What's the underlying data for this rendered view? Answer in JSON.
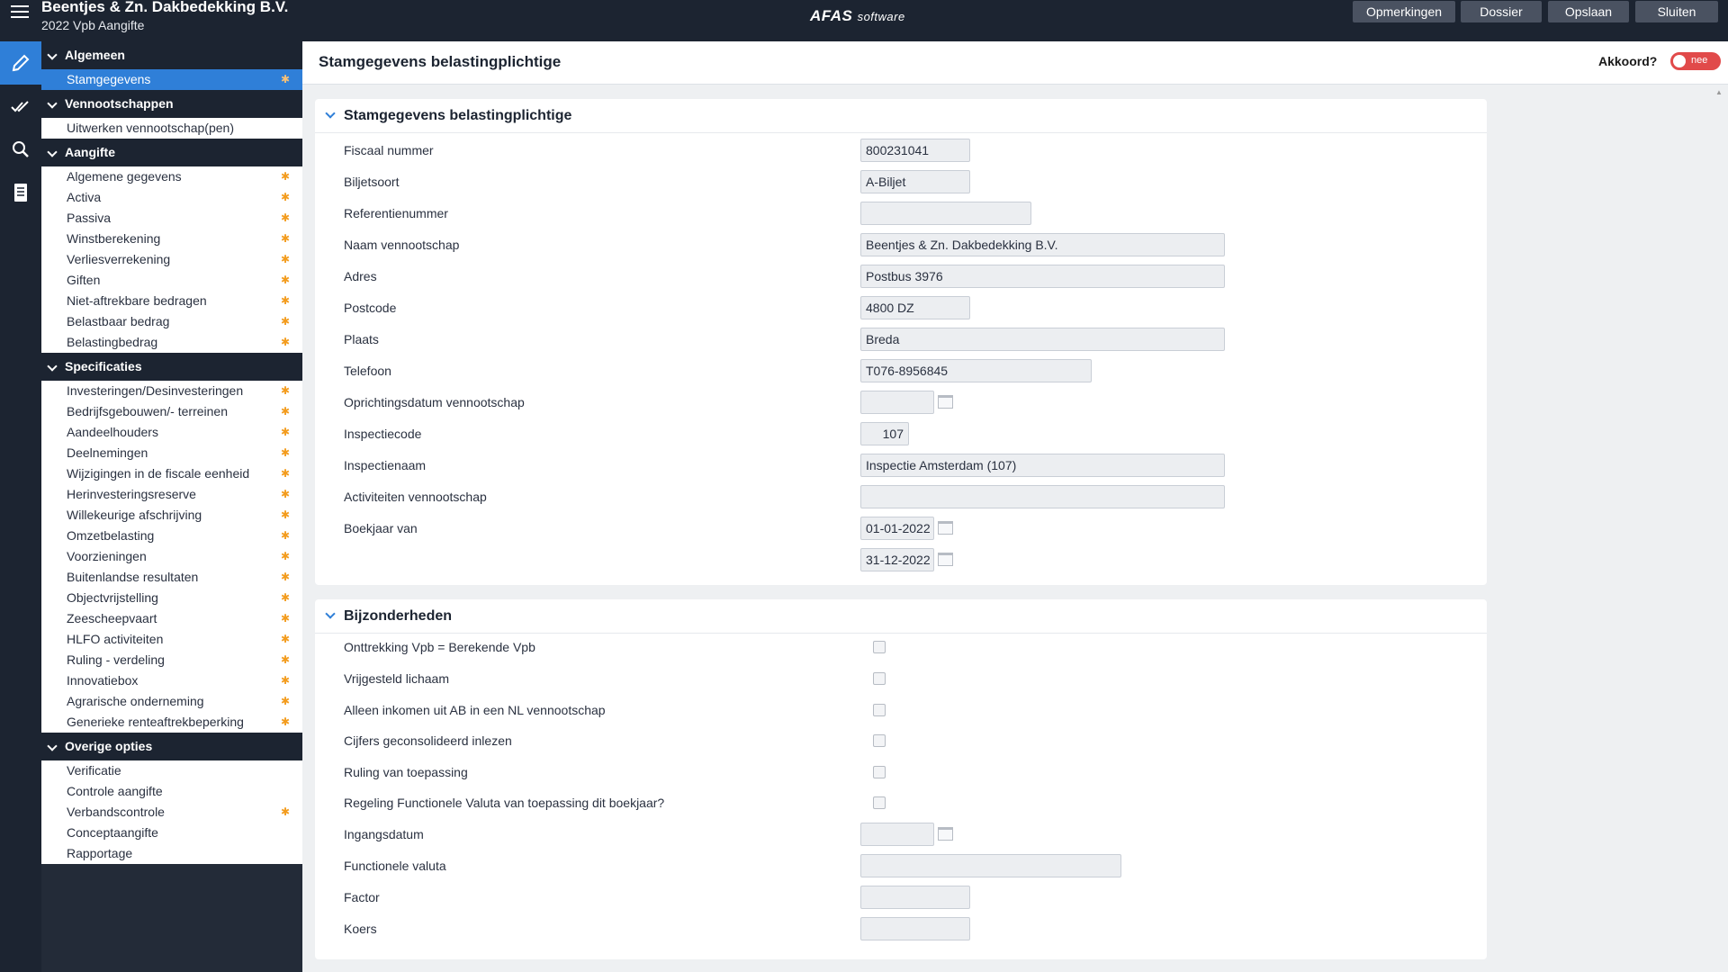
{
  "header": {
    "company": "Beentjes & Zn. Dakbedekking B.V.",
    "subtitle": "2022 Vpb Aangifte",
    "logo_brand": "AFAS",
    "logo_suffix": "software",
    "buttons": [
      "Opmerkingen",
      "Dossier",
      "Opslaan",
      "Sluiten"
    ]
  },
  "rail": {
    "icons": [
      "pencil-icon",
      "double-check-icon",
      "search-icon",
      "document-icon"
    ]
  },
  "nav": {
    "groups": [
      {
        "title": "Algemeen",
        "items": [
          {
            "label": "Stamgegevens",
            "star": true,
            "selected": true
          }
        ]
      },
      {
        "title": "Vennootschappen",
        "items": [
          {
            "label": "Uitwerken vennootschap(pen)",
            "star": false
          }
        ]
      },
      {
        "title": "Aangifte",
        "items": [
          {
            "label": "Algemene gegevens",
            "star": true
          },
          {
            "label": "Activa",
            "star": true
          },
          {
            "label": "Passiva",
            "star": true
          },
          {
            "label": "Winstberekening",
            "star": true
          },
          {
            "label": "Verliesverrekening",
            "star": true
          },
          {
            "label": "Giften",
            "star": true
          },
          {
            "label": "Niet-aftrekbare bedragen",
            "star": true
          },
          {
            "label": "Belastbaar bedrag",
            "star": true
          },
          {
            "label": "Belastingbedrag",
            "star": true
          }
        ]
      },
      {
        "title": "Specificaties",
        "items": [
          {
            "label": "Investeringen/Desinvesteringen",
            "star": true
          },
          {
            "label": "Bedrijfsgebouwen/- terreinen",
            "star": true
          },
          {
            "label": "Aandeelhouders",
            "star": true
          },
          {
            "label": "Deelnemingen",
            "star": true
          },
          {
            "label": "Wijzigingen in de fiscale eenheid",
            "star": true
          },
          {
            "label": "Herinvesteringsreserve",
            "star": true
          },
          {
            "label": "Willekeurige afschrijving",
            "star": true
          },
          {
            "label": "Omzetbelasting",
            "star": true
          },
          {
            "label": "Voorzieningen",
            "star": true
          },
          {
            "label": "Buitenlandse resultaten",
            "star": true
          },
          {
            "label": "Objectvrijstelling",
            "star": true
          },
          {
            "label": "Zeescheepvaart",
            "star": true
          },
          {
            "label": "HLFO activiteiten",
            "star": true
          },
          {
            "label": "Ruling - verdeling",
            "star": true
          },
          {
            "label": "Innovatiebox",
            "star": true
          },
          {
            "label": "Agrarische onderneming",
            "star": true
          },
          {
            "label": "Generieke renteaftrekbeperking",
            "star": true
          }
        ]
      },
      {
        "title": "Overige opties",
        "items": [
          {
            "label": "Verificatie",
            "star": false
          },
          {
            "label": "Controle aangifte",
            "star": false
          },
          {
            "label": "Verbandscontrole",
            "star": true
          },
          {
            "label": "Conceptaangifte",
            "star": false
          },
          {
            "label": "Rapportage",
            "star": false
          }
        ]
      }
    ],
    "star_glyph": "✱"
  },
  "page": {
    "title": "Stamgegevens belastingplichtige",
    "akkoord_label": "Akkoord?",
    "akkoord_value": "nee",
    "akkoord_color": "#e14a4a"
  },
  "section1": {
    "title": "Stamgegevens belastingplichtige",
    "fields": {
      "fiscaal_nummer": {
        "label": "Fiscaal nummer",
        "value": "800231041"
      },
      "biljetsoort": {
        "label": "Biljetsoort",
        "value": "A-Biljet"
      },
      "referentienummer": {
        "label": "Referentienummer",
        "value": ""
      },
      "naam": {
        "label": "Naam vennootschap",
        "value": "Beentjes & Zn. Dakbedekking B.V."
      },
      "adres": {
        "label": "Adres",
        "value": "Postbus 3976"
      },
      "postcode": {
        "label": "Postcode",
        "value": "4800 DZ"
      },
      "plaats": {
        "label": "Plaats",
        "value": "Breda"
      },
      "telefoon": {
        "label": "Telefoon",
        "value": "T076-8956845"
      },
      "oprichtingsdatum": {
        "label": "Oprichtingsdatum vennootschap",
        "value": ""
      },
      "inspectiecode": {
        "label": "Inspectiecode",
        "value": "107"
      },
      "inspectienaam": {
        "label": "Inspectienaam",
        "value": "Inspectie Amsterdam (107)"
      },
      "activiteiten": {
        "label": "Activiteiten vennootschap",
        "value": ""
      },
      "boekjaar_van": {
        "label": "Boekjaar van",
        "value": "01-01-2022"
      },
      "boekjaar_tot": {
        "value": "31-12-2022"
      }
    }
  },
  "section2": {
    "title": "Bijzonderheden",
    "checkboxes": [
      {
        "label": "Onttrekking Vpb = Berekende Vpb",
        "checked": false
      },
      {
        "label": "Vrijgesteld lichaam",
        "checked": false
      },
      {
        "label": "Alleen inkomen uit AB in een NL vennootschap",
        "checked": false
      },
      {
        "label": "Cijfers geconsolideerd inlezen",
        "checked": false
      },
      {
        "label": "Ruling van toepassing",
        "checked": false
      },
      {
        "label": "Regeling Functionele Valuta van toepassing dit boekjaar?",
        "checked": false
      }
    ],
    "fields": {
      "ingangsdatum": {
        "label": "Ingangsdatum",
        "value": ""
      },
      "functionele_valuta": {
        "label": "Functionele valuta",
        "value": ""
      },
      "factor": {
        "label": "Factor",
        "value": ""
      },
      "koers": {
        "label": "Koers",
        "value": ""
      }
    }
  }
}
